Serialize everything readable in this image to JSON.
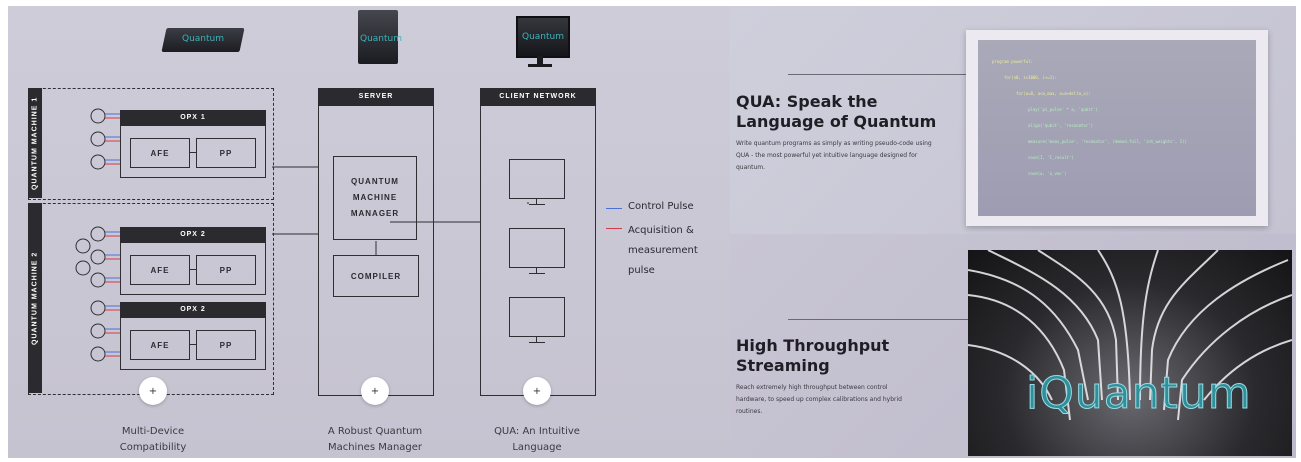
{
  "diagram": {
    "machines": [
      {
        "label": "QUANTUM MACHINE 1"
      },
      {
        "label": "QUANTUM MACHINE 2"
      }
    ],
    "opx": [
      {
        "title": "OPX 1",
        "afe": "AFE",
        "pp": "PP"
      },
      {
        "title": "OPX 2",
        "afe": "AFE",
        "pp": "PP"
      },
      {
        "title": "OPX 2",
        "afe": "AFE",
        "pp": "PP"
      }
    ],
    "server": {
      "header": "SERVER",
      "manager": "QUANTUM MACHINE MANAGER",
      "compiler": "COMPILER"
    },
    "client": {
      "header": "CLIENT NETWORK"
    },
    "device_brands": [
      "Quantum",
      "Quantum",
      "Quantum"
    ],
    "legend": [
      {
        "label": "Control Pulse",
        "color": "#4a6fd6"
      },
      {
        "label": "Acquisition & measurement pulse",
        "color": "#d23a4a"
      }
    ],
    "features": [
      {
        "plus": "+",
        "caption": "Multi-Device Compatibility"
      },
      {
        "plus": "+",
        "caption": "A Robust Quantum Machines Manager"
      },
      {
        "plus": "+",
        "caption": "QUA: An Intuitive Language"
      }
    ]
  },
  "qua": {
    "title": "QUA: Speak the Language of Quantum",
    "description": "Write quantum programs as simply as writing pseudo-code using QUA - the most powerful yet intuitive language designed for quantum.",
    "code_lines": [
      "program powerful:",
      "for(n0, i<1000, i+=1):",
      "for(a=0, a<a_max, a=a+delta_a):",
      "play('pi_pulse' * a, 'qubit')",
      "align('qubit', 'resonator')",
      "measure('meas_pulse', 'resonator', (demod.full, 'int_weights', I))",
      "save(I, 'I_result')",
      "save(a, 'a_vec')"
    ]
  },
  "streaming": {
    "title": "High Throughput Streaming",
    "description": "Reach extremely high throughput between control hardware, to speed up complex calibrations and hybrid routines.",
    "brand": "iQuantum"
  }
}
